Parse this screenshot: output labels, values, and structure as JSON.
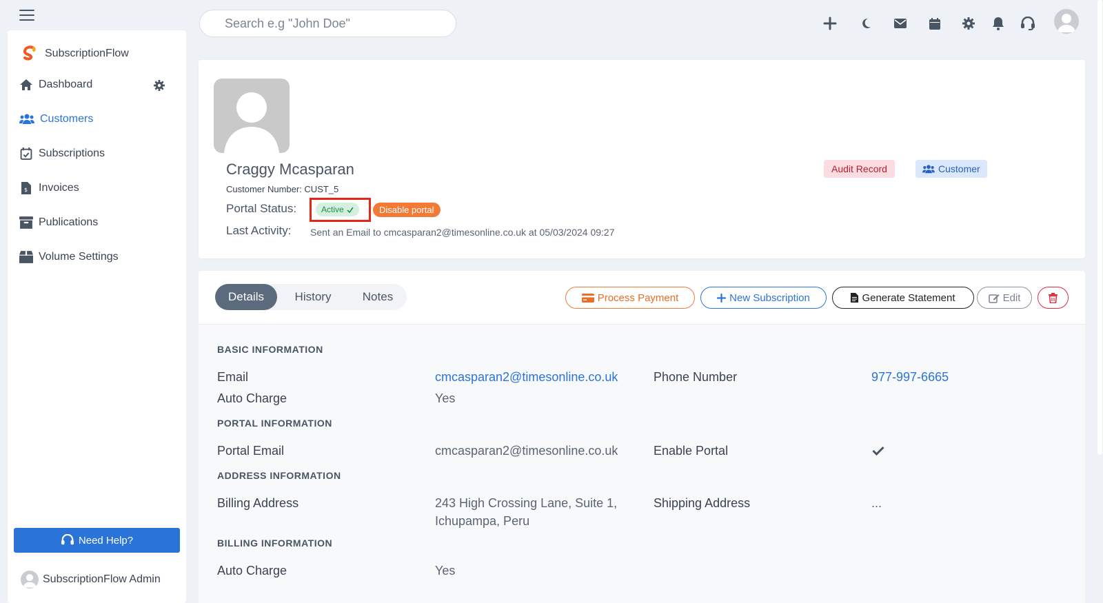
{
  "topbar": {
    "search_placeholder": "Search e.g \"John Doe\""
  },
  "sidebar": {
    "brand": "SubscriptionFlow",
    "items": [
      {
        "label": "Dashboard"
      },
      {
        "label": "Customers",
        "active": true
      },
      {
        "label": "Subscriptions"
      },
      {
        "label": "Invoices"
      },
      {
        "label": "Publications"
      },
      {
        "label": "Volume Settings"
      }
    ],
    "help_label": "Need Help?",
    "admin_name": "SubscriptionFlow Admin"
  },
  "profile": {
    "name": "Craggy Mcasparan",
    "customer_number": "Customer Number: CUST_5",
    "portal_status_label": "Portal Status:",
    "portal_status": "Active",
    "disable_portal_label": "Disable portal",
    "last_activity_label": "Last Activity:",
    "last_activity": "Sent an Email to cmcasparan2@timesonline.co.uk at 05/03/2024 09:27",
    "audit_label": "Audit Record",
    "customer_label": "Customer"
  },
  "details": {
    "tabs": [
      {
        "label": "Details",
        "active": true
      },
      {
        "label": "History"
      },
      {
        "label": "Notes"
      }
    ],
    "actions": {
      "process_payment": "Process Payment",
      "new_subscription": "New Subscription",
      "generate_statement": "Generate Statement",
      "edit": "Edit"
    },
    "sections": {
      "basic": "BASIC INFORMATION",
      "portal": "PORTAL INFORMATION",
      "address": "ADDRESS INFORMATION",
      "billing": "BILLING INFORMATION"
    },
    "fields": {
      "email_label": "Email",
      "email": "cmcasparan2@timesonline.co.uk",
      "phone_label": "Phone Number",
      "phone": "977-997-6665",
      "auto_charge_label": "Auto Charge",
      "auto_charge": "Yes",
      "portal_email_label": "Portal Email",
      "portal_email": "cmcasparan2@timesonline.co.uk",
      "enable_portal_label": "Enable Portal",
      "billing_address_label": "Billing Address",
      "billing_address_line1": "243 High Crossing Lane, Suite 1,",
      "billing_address_line2": "Ichupampa, Peru",
      "shipping_address_label": "Shipping Address",
      "shipping_address": "...",
      "billing_auto_charge_label": "Auto Charge",
      "billing_auto_charge": "Yes"
    }
  },
  "colors": {
    "accent": "#2a73d9",
    "active_green": "#228b4a",
    "orange": "#f37a35",
    "danger": "#e02b3c"
  }
}
